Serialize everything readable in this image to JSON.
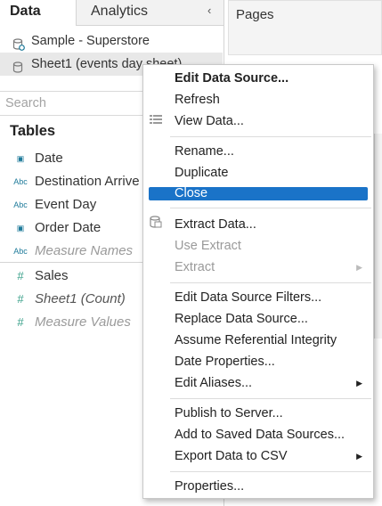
{
  "tabs": {
    "data": "Data",
    "analytics": "Analytics",
    "collapse": "‹"
  },
  "sources": [
    {
      "label": "Sample - Superstore"
    },
    {
      "label": "Sheet1 (events day sheet)"
    }
  ],
  "search": {
    "placeholder": "Search"
  },
  "tables_header": "Tables",
  "fields": [
    {
      "type": "date",
      "icon": "▣",
      "label": "Date"
    },
    {
      "type": "abc",
      "icon": "Abc",
      "label": "Destination Arrive"
    },
    {
      "type": "abc",
      "icon": "Abc",
      "label": "Event Day"
    },
    {
      "type": "date",
      "icon": "▣",
      "label": "Order Date"
    },
    {
      "type": "abc",
      "icon": "Abc",
      "label": "Measure Names"
    },
    {
      "type": "measure",
      "icon": "#",
      "label": "Sales"
    },
    {
      "type": "measure",
      "icon": "#",
      "label": "Sheet1 (Count)"
    },
    {
      "type": "measure",
      "icon": "#",
      "label": "Measure Values"
    }
  ],
  "pages_label": "Pages",
  "menu": {
    "edit_data_source": "Edit Data Source...",
    "refresh": "Refresh",
    "view_data": "View Data...",
    "rename": "Rename...",
    "duplicate": "Duplicate",
    "close": "Close",
    "extract_data": "Extract Data...",
    "use_extract": "Use Extract",
    "extract": "Extract",
    "edit_filters": "Edit Data Source Filters...",
    "replace_ds": "Replace Data Source...",
    "assume_ri": "Assume Referential Integrity",
    "date_props": "Date Properties...",
    "edit_aliases": "Edit Aliases...",
    "publish": "Publish to Server...",
    "add_saved": "Add to Saved Data Sources...",
    "export_csv": "Export Data to CSV",
    "properties": "Properties..."
  }
}
